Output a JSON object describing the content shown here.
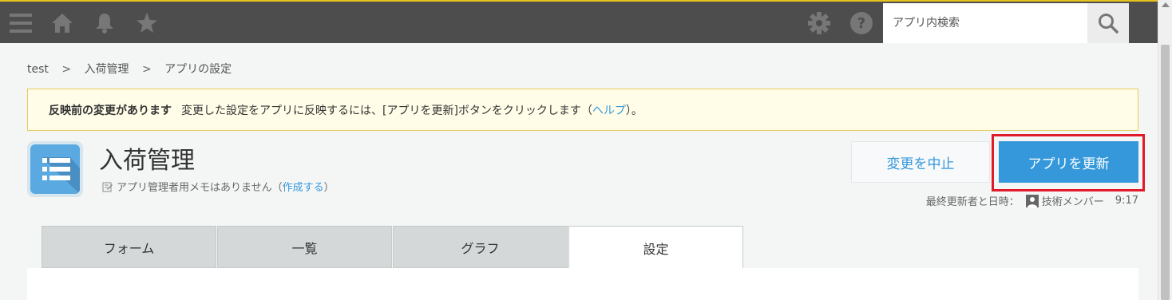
{
  "header": {
    "search_placeholder": "アプリ内検索",
    "icons": [
      "menu-icon",
      "home-icon",
      "bell-icon",
      "star-icon",
      "gear-icon",
      "help-icon",
      "search-icon"
    ]
  },
  "breadcrumb": {
    "items": [
      "test",
      "入荷管理",
      "アプリの設定"
    ],
    "separator": ">"
  },
  "notice": {
    "title": "反映前の変更があります",
    "message_before": "変更した設定をアプリに反映するには、[アプリを更新]ボタンをクリックします（",
    "help_link": "ヘルプ",
    "message_after": "）。"
  },
  "app": {
    "name": "入荷管理",
    "memo_text": "アプリ管理者用メモはありません（",
    "memo_link": "作成する",
    "memo_after": "）"
  },
  "actions": {
    "cancel_label": "変更を中止",
    "update_label": "アプリを更新"
  },
  "last_updated": {
    "label": "最終更新者と日時：",
    "user": "技術メンバー",
    "time": "9:17"
  },
  "tabs": [
    {
      "label": "フォーム",
      "active": false
    },
    {
      "label": "一覧",
      "active": false
    },
    {
      "label": "グラフ",
      "active": false
    },
    {
      "label": "設定",
      "active": true
    }
  ],
  "colors": {
    "header_bg": "#4d4d4d",
    "accent_blue": "#3498db",
    "highlight_red": "#e0192b",
    "notice_bg": "#fffde8"
  }
}
